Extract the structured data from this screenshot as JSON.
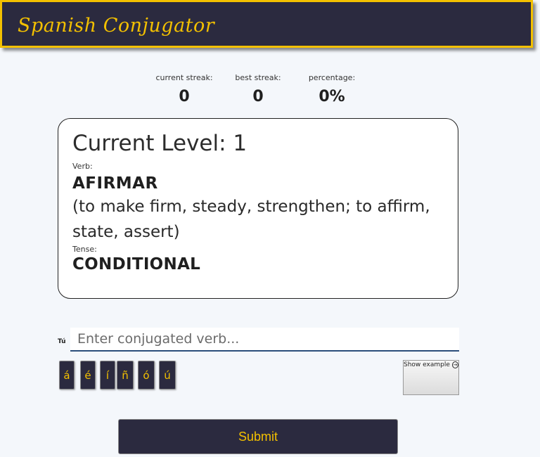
{
  "header": {
    "title": "Spanish Conjugator"
  },
  "stats": [
    {
      "label": "current streak:",
      "value": "0"
    },
    {
      "label": "best streak:",
      "value": "0"
    },
    {
      "label": "percentage:",
      "value": "0%"
    }
  ],
  "card": {
    "level_text": "Current Level: 1",
    "verb_label": "Verb:",
    "verb": "AFIRMAR",
    "meaning": "(to make firm, steady, strengthen; to affirm, state, assert)",
    "tense_label": "Tense:",
    "tense": "CONDITIONAL"
  },
  "answer": {
    "pronoun": "Tú",
    "placeholder": "Enter conjugated verb...",
    "value": ""
  },
  "accents": [
    "á",
    "é",
    "í",
    "ñ",
    "ó",
    "ú"
  ],
  "show_example": {
    "label": "Show example",
    "icon": "circle-arrow-right-icon"
  },
  "submit": {
    "label": "Submit"
  },
  "colors": {
    "accent": "#f3c000",
    "dark": "#2b2a3f",
    "input_underline": "#2a4d7a"
  }
}
